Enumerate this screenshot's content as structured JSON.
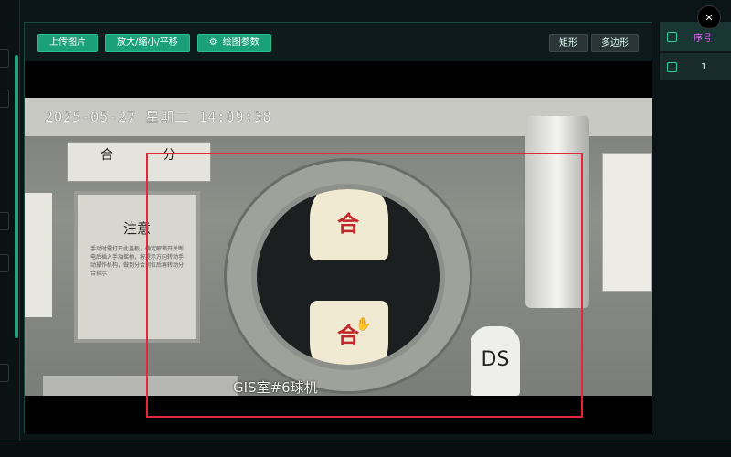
{
  "toolbar": {
    "upload_label": "上传图片",
    "zoom_pan_label": "放大/缩小/平移",
    "draw_params_label": "绘图参数",
    "rect_label": "矩形",
    "polygon_label": "多边形"
  },
  "camera": {
    "timestamp": "2025-05-27  星期二  14:09:38",
    "location_label": "GIS室#6球机",
    "close_plate": "合",
    "open_plate": "分",
    "notice_title": "注意",
    "notice_body": "手动时需打开此盖板，确定解锁开关断电后插入手动摇柄，按提示方向转动手动操作机构，做到分合到位后再转动分合指示",
    "gauge_top": "合",
    "gauge_bottom": "合",
    "ds_label": "DS"
  },
  "list_panel": {
    "header_label": "序号",
    "rows": [
      {
        "index": "1"
      }
    ]
  },
  "colors": {
    "accent": "#1aa07a",
    "roi": "#e8263a"
  },
  "icons": {
    "gear": "gear-icon",
    "close": "close-icon",
    "cursor": "hand-cursor-icon"
  }
}
